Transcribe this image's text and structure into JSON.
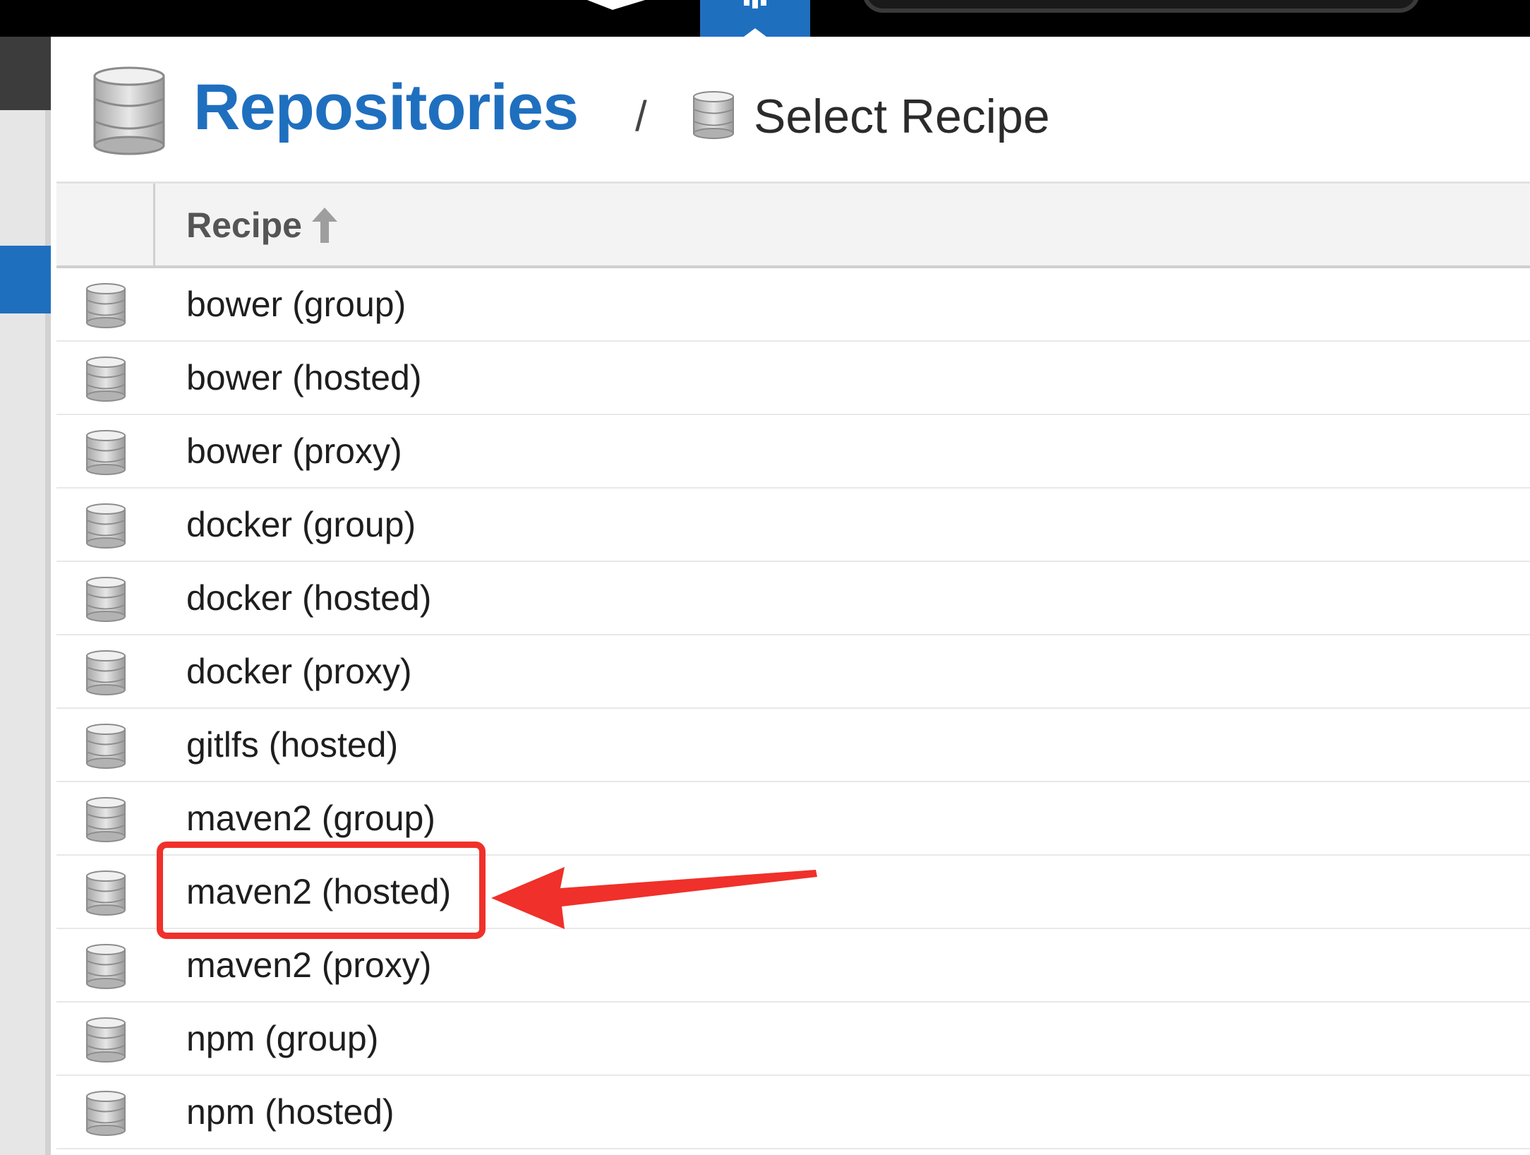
{
  "header": {
    "title": "Repositories",
    "separator": "/",
    "subtitle": "Select Recipe"
  },
  "grid": {
    "column": "Recipe",
    "sort": "ascending",
    "rows": [
      "bower (group)",
      "bower (hosted)",
      "bower (proxy)",
      "docker (group)",
      "docker (hosted)",
      "docker (proxy)",
      "gitlfs (hosted)",
      "maven2 (group)",
      "maven2 (hosted)",
      "maven2 (proxy)",
      "npm (group)",
      "npm (hosted)"
    ],
    "highlighted": "maven2 (hosted)"
  },
  "colors": {
    "accent": "#1f6fbf",
    "annotation": "#f0302a",
    "topbar": "#000000"
  },
  "icons": {
    "row": "database-icon",
    "header": "database-icon",
    "sort": "sort-ascending-icon"
  }
}
